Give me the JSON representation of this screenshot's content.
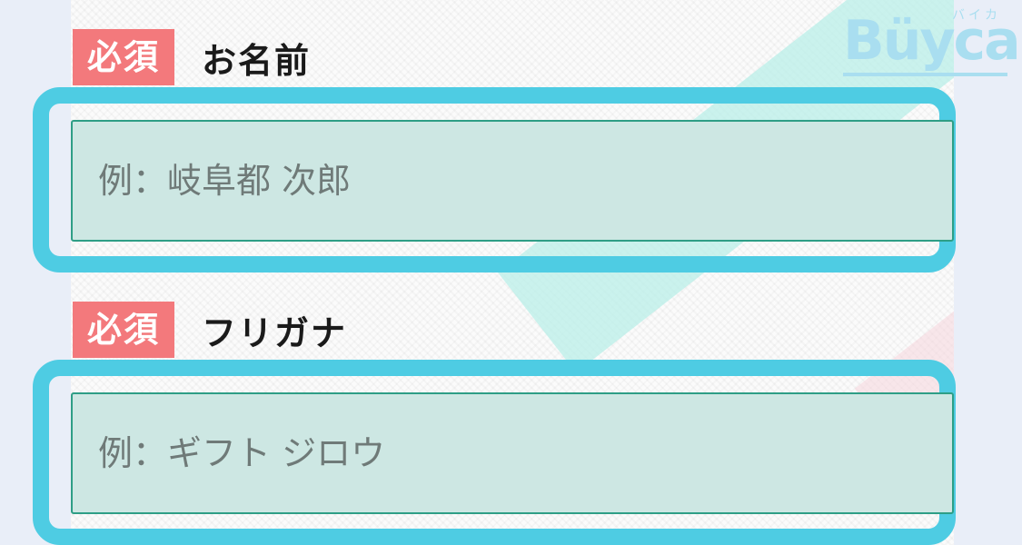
{
  "brand": {
    "logo_text": "Büyca",
    "logo_kana": "バイカ",
    "highlight_color": "#4ecce3",
    "required_color": "#f3797c"
  },
  "form": {
    "fields": [
      {
        "required_label": "必須",
        "label": "お名前",
        "placeholder": "例：岐阜都 次郎",
        "value": ""
      },
      {
        "required_label": "必須",
        "label": "フリガナ",
        "placeholder": "例：ギフト ジロウ",
        "value": ""
      }
    ]
  }
}
